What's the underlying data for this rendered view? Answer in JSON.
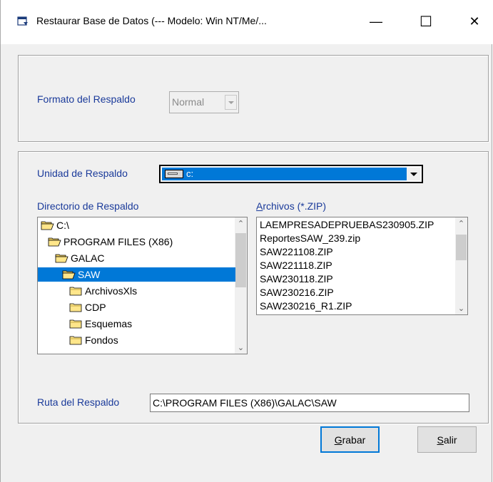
{
  "window": {
    "title": "Restaurar Base de Datos  (--- Modelo: Win NT/Me/...",
    "minimize_glyph": "—",
    "maximize_glyph": "☐",
    "close_glyph": "✕"
  },
  "format_group": {
    "label": "Formato del Respaldo",
    "value": "Normal"
  },
  "drive": {
    "label": "Unidad de Respaldo",
    "value": "c:"
  },
  "directory": {
    "label": "Directorio de Respaldo",
    "items": [
      {
        "label": "C:\\",
        "indent": 0,
        "open": true,
        "selected": false
      },
      {
        "label": "PROGRAM FILES (X86)",
        "indent": 1,
        "open": true,
        "selected": false
      },
      {
        "label": "GALAC",
        "indent": 2,
        "open": true,
        "selected": false
      },
      {
        "label": "SAW",
        "indent": 3,
        "open": true,
        "selected": true
      },
      {
        "label": "ArchivosXls",
        "indent": 4,
        "open": false,
        "selected": false
      },
      {
        "label": "CDP",
        "indent": 4,
        "open": false,
        "selected": false
      },
      {
        "label": "Esquemas",
        "indent": 4,
        "open": false,
        "selected": false
      },
      {
        "label": "Fondos",
        "indent": 4,
        "open": false,
        "selected": false
      }
    ]
  },
  "files": {
    "label_prefix": "A",
    "label_rest": "rchivos (*.ZIP)",
    "items": [
      "LAEMPRESADEPRUEBAS230905.ZIP",
      "ReportesSAW_239.zip",
      "SAW221108.ZIP",
      "SAW221118.ZIP",
      "SAW230118.ZIP",
      "SAW230216.ZIP",
      "SAW230216_R1.ZIP"
    ]
  },
  "path": {
    "label": "Ruta del Respaldo",
    "value": "C:\\PROGRAM FILES (X86)\\GALAC\\SAW"
  },
  "buttons": {
    "save_key": "G",
    "save_rest": "rabar",
    "exit_key": "S",
    "exit_rest": "alir"
  },
  "colors": {
    "label_blue": "#1a3a9a",
    "selection": "#0078d7",
    "window_bg": "#f0f0f0"
  }
}
